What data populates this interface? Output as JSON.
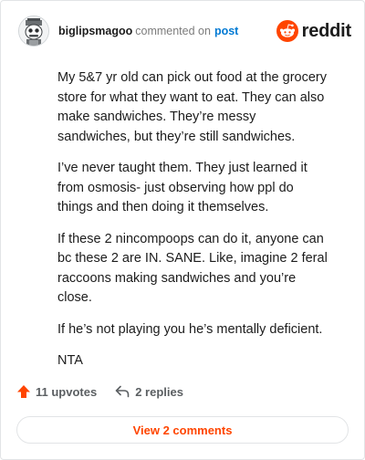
{
  "header": {
    "username": "biglipsmagoo",
    "action": "commented on",
    "post_link": "post",
    "brand": "reddit",
    "avatar_icon": "snoo-avatar-icon",
    "brand_color": "#ff4500",
    "link_color": "#0079d3"
  },
  "comment": {
    "paragraphs": [
      "My 5&7 yr old can pick out food at the grocery store for what they want to eat. They can also make sandwiches. They’re messy sandwiches, but they’re still sandwiches.",
      "I’ve never taught them. They just learned it from osmosis- just observing how ppl do things and then doing it themselves.",
      "If these 2 nincompoops can do it, anyone can bc these 2 are IN. SANE. Like, imagine 2 feral raccoons making sandwiches and you’re close.",
      "If he’s not playing you he’s mentally deficient.",
      "NTA"
    ]
  },
  "footer": {
    "upvotes": "11 upvotes",
    "replies": "2 replies",
    "upvote_icon": "upvote-arrow-icon",
    "reply_icon": "reply-arrow-icon",
    "upvote_color": "#ff4500"
  },
  "view_button": {
    "label": "View 2 comments"
  }
}
